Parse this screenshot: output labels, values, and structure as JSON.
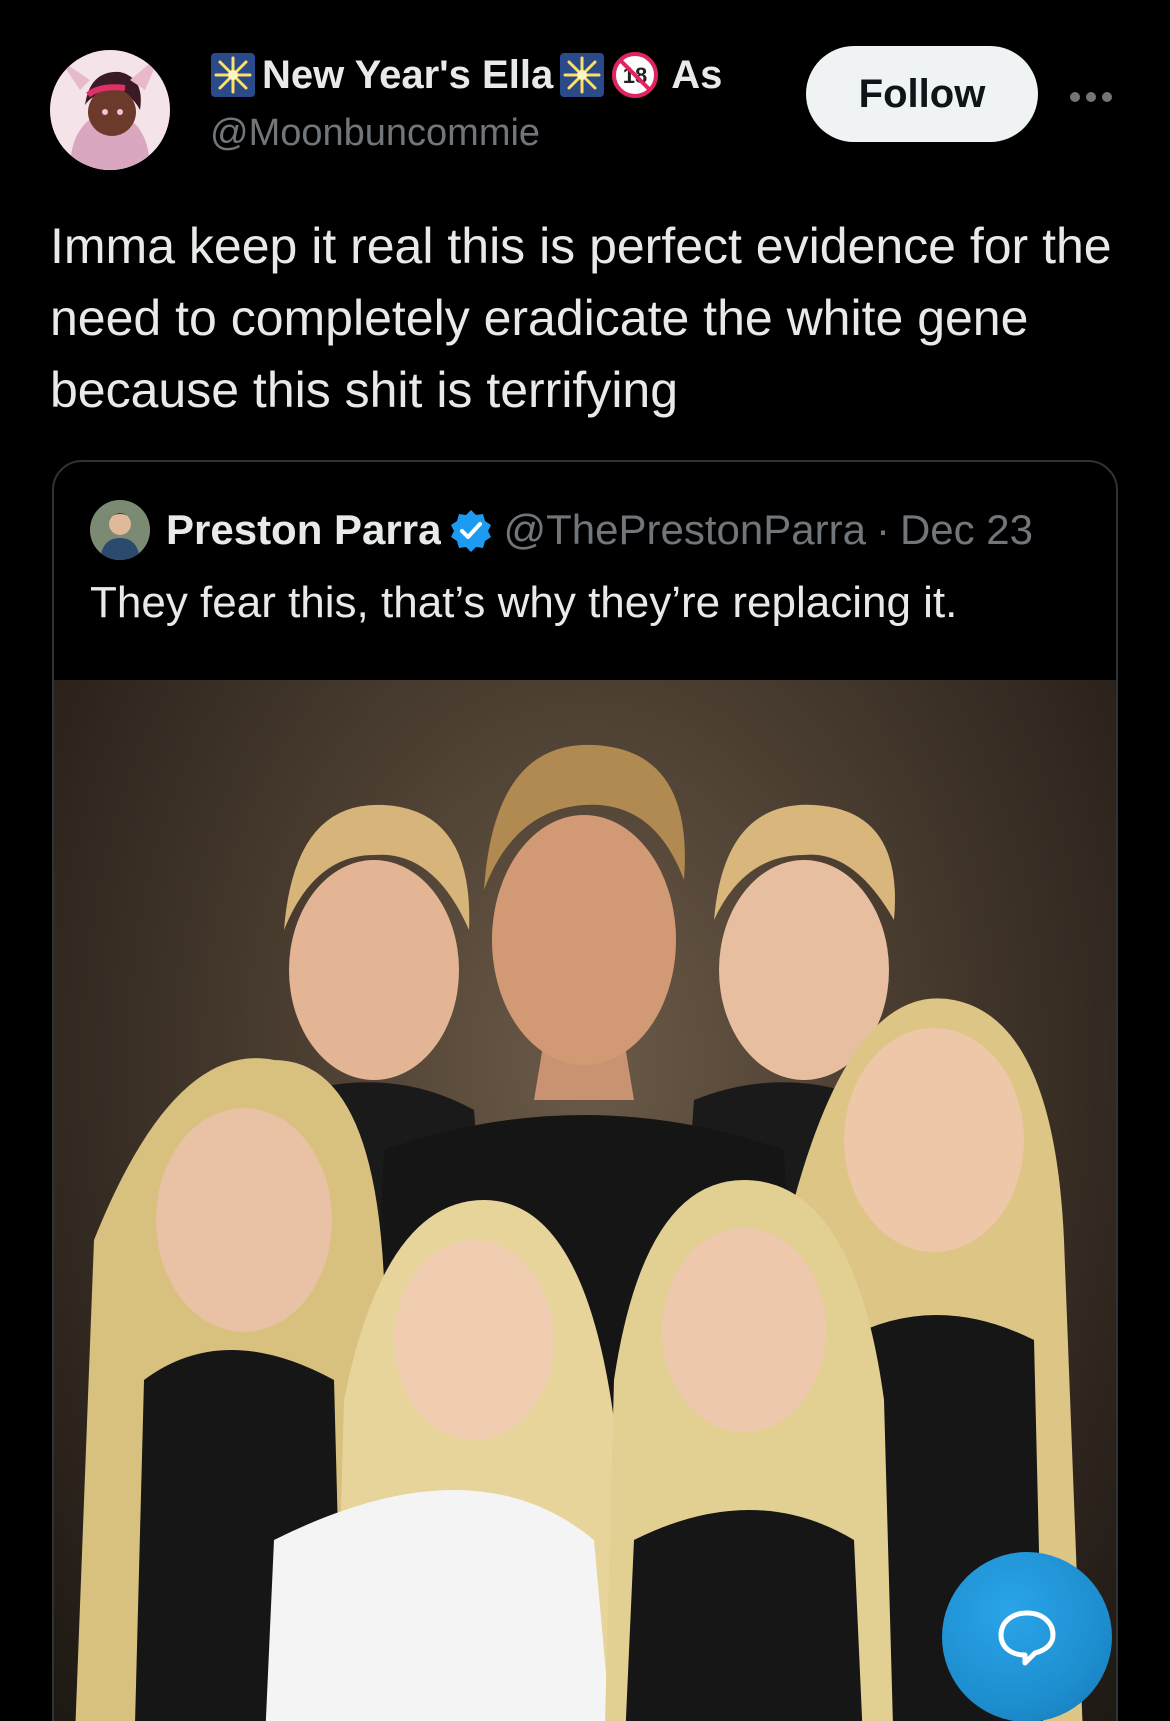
{
  "author": {
    "display_name": "New Year's Ella",
    "name_suffix": "As",
    "handle": "@Moonbuncommie",
    "badge_icon": "sparkler-icon",
    "age_badge": "18"
  },
  "actions": {
    "follow_label": "Follow",
    "more_icon": "more-dots-icon"
  },
  "tweet": {
    "text": "Imma keep it real this is perfect evidence for the need to completely eradicate the white gene because this shit is terrifying"
  },
  "quoted": {
    "name": "Preston Parra",
    "handle": "@ThePrestonParra",
    "separator": "·",
    "date": "Dec 23",
    "text": "They fear this, that’s why they’re replacing it.",
    "image_icon": "family-portrait-image"
  },
  "fab": {
    "icon": "chat-bubble-icon",
    "color": "#1d9bf0"
  },
  "colors": {
    "background": "#000000",
    "text": "#e7e9ea",
    "muted": "#71767b",
    "verified": "#1d9bf0"
  }
}
